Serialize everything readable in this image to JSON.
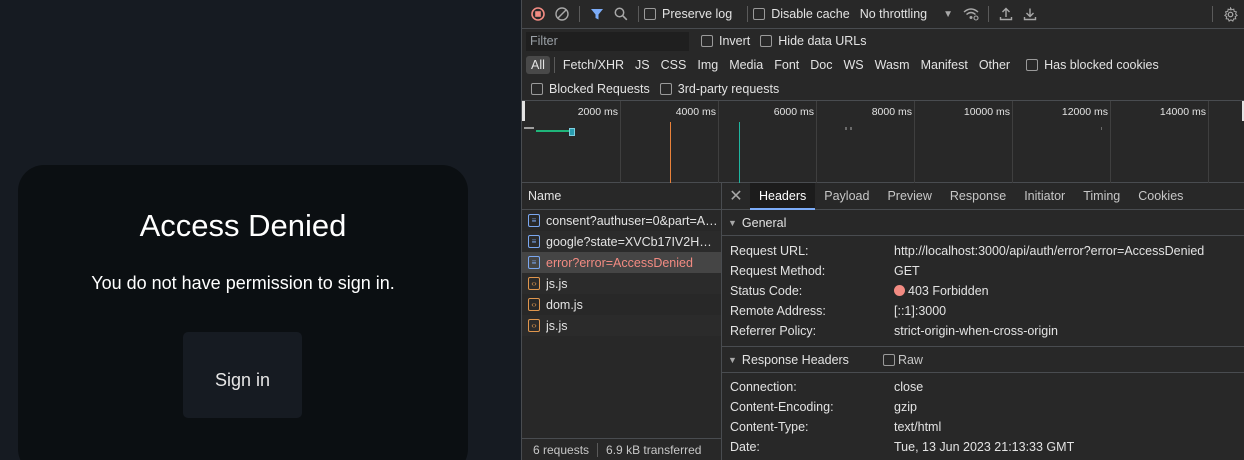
{
  "page": {
    "title": "Access Denied",
    "message": "You do not have permission to sign in.",
    "signin_label": "Sign in"
  },
  "devtools": {
    "toolbar": {
      "preserve_log": "Preserve log",
      "disable_cache": "Disable cache",
      "throttling": "No throttling"
    },
    "filter": {
      "placeholder": "Filter",
      "invert": "Invert",
      "hide_data_urls": "Hide data URLs"
    },
    "types": [
      "All",
      "Fetch/XHR",
      "JS",
      "CSS",
      "Img",
      "Media",
      "Font",
      "Doc",
      "WS",
      "Wasm",
      "Manifest",
      "Other"
    ],
    "active_type": "All",
    "has_blocked_cookies": "Has blocked cookies",
    "blocked_requests": "Blocked Requests",
    "third_party": "3rd-party requests",
    "timeline": {
      "ticks": [
        "2000 ms",
        "4000 ms",
        "6000 ms",
        "8000 ms",
        "10000 ms",
        "12000 ms",
        "14000 ms"
      ]
    },
    "requests": {
      "header": "Name",
      "items": [
        {
          "name": "consent?authuser=0&part=AJi8h",
          "type": "doc"
        },
        {
          "name": "google?state=XVCb17IV2HWvD",
          "type": "doc"
        },
        {
          "name": "error?error=AccessDenied",
          "type": "doc"
        },
        {
          "name": "js.js",
          "type": "js"
        },
        {
          "name": "dom.js",
          "type": "js"
        },
        {
          "name": "js.js",
          "type": "js"
        }
      ],
      "count": "6 requests",
      "transferred": "6.9 kB transferred"
    },
    "tabs": [
      "Headers",
      "Payload",
      "Preview",
      "Response",
      "Initiator",
      "Timing",
      "Cookies"
    ],
    "active_tab": "Headers",
    "general": {
      "title": "General",
      "rows": [
        {
          "key": "Request URL:",
          "value": "http://localhost:3000/api/auth/error?error=AccessDenied"
        },
        {
          "key": "Request Method:",
          "value": "GET"
        },
        {
          "key": "Status Code:",
          "value": "403 Forbidden"
        },
        {
          "key": "Remote Address:",
          "value": "[::1]:3000"
        },
        {
          "key": "Referrer Policy:",
          "value": "strict-origin-when-cross-origin"
        }
      ]
    },
    "response_headers": {
      "title": "Response Headers",
      "raw_label": "Raw",
      "rows": [
        {
          "key": "Connection:",
          "value": "close"
        },
        {
          "key": "Content-Encoding:",
          "value": "gzip"
        },
        {
          "key": "Content-Type:",
          "value": "text/html"
        },
        {
          "key": "Date:",
          "value": "Tue, 13 Jun 2023 21:13:33 GMT"
        }
      ]
    },
    "colors": {
      "status_error": "#f28b82",
      "accent": "#7cacf8",
      "timeline_orange": "#e8813a",
      "timeline_teal": "#1fb5a0"
    }
  }
}
